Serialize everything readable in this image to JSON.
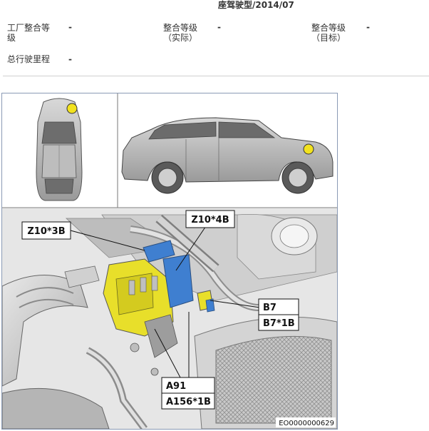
{
  "header": {
    "title": "座驾驶型/2014/07"
  },
  "fields": {
    "factory_grade": {
      "label_line1": "工厂整合等",
      "label_line2": "级",
      "value": "-"
    },
    "actual_grade": {
      "label_line1": "整合等级",
      "label_line2": "（实际）",
      "value": "-"
    },
    "target_grade": {
      "label_line1": "整合等级",
      "label_line2": "（目标）",
      "value": "-"
    },
    "mileage": {
      "label": "总行驶里程",
      "value": "-"
    }
  },
  "figure": {
    "callouts": {
      "z10_3b": "Z10*3B",
      "z10_4b": "Z10*4B",
      "b7": "B7",
      "b7_1b": "B7*1B",
      "a91": "A91",
      "a156_1b": "A156*1B"
    },
    "caption": "EO0000000629",
    "colors": {
      "marker": "#f2e21e",
      "highlight_yellow": "#e8df2a",
      "highlight_blue": "#3f7fd0",
      "border": "#8a9ab5"
    }
  }
}
